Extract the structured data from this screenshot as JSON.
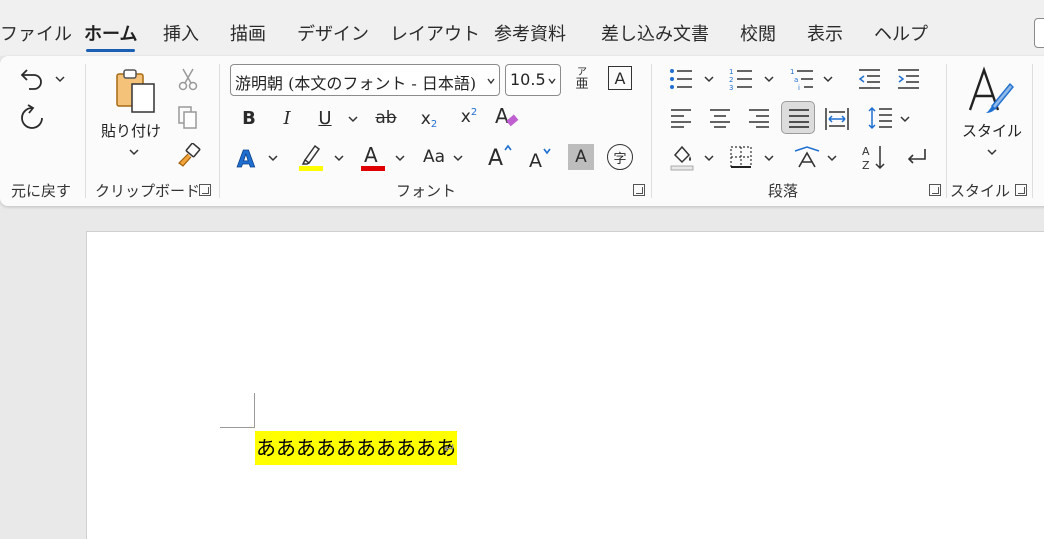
{
  "tabs": [
    "ファイル",
    "ホーム",
    "挿入",
    "描画",
    "デザイン",
    "レイアウト",
    "参考資料",
    "差し込み文書",
    "校閲",
    "表示",
    "ヘルプ"
  ],
  "active_tab": "ホーム",
  "groups": {
    "undo": "元に戻す",
    "clipboard": "クリップボード",
    "font": "フォント",
    "paragraph": "段落",
    "styles": "スタイル"
  },
  "clipboard": {
    "paste_label": "貼り付け"
  },
  "font": {
    "family": "游明朝 (本文のフォント - 日本語)",
    "size": "10.5",
    "phonetic_guide_glyph": "亜",
    "phonetic_small": "ア",
    "char_border_glyph": "A",
    "change_case_glyph": "Aa",
    "enclose_glyph": "字",
    "highlight_color": "#ffff00",
    "font_color": "#e00000",
    "text_effect_color": "#1f6fd1"
  },
  "styles": {
    "label": "スタイル"
  },
  "document": {
    "text": "ああああああああああ",
    "paragraph_mark": "↵",
    "highlight": "#ffff00"
  }
}
